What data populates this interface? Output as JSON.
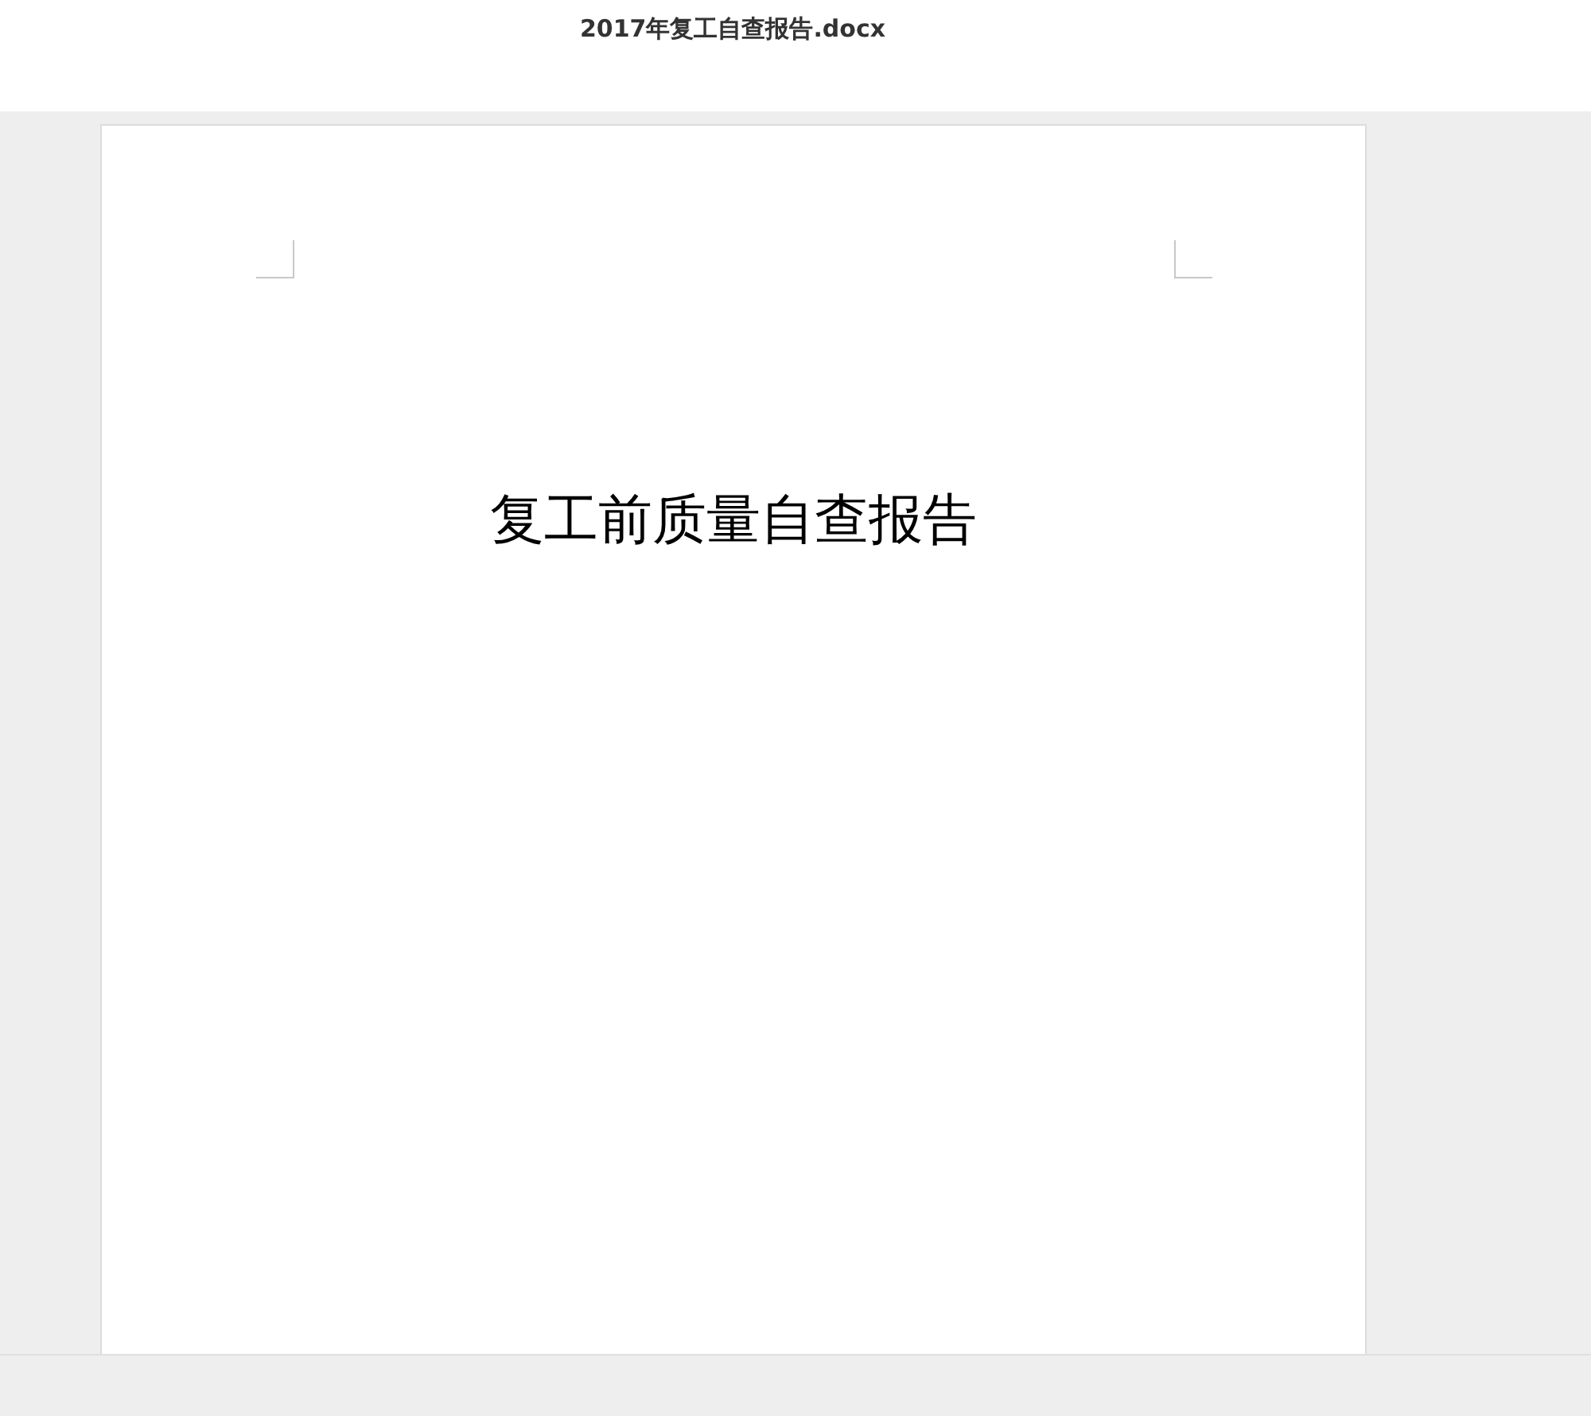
{
  "window": {
    "title": "2017年复工自查报告.docx"
  },
  "document": {
    "heading": "复工前质量自查报告"
  }
}
